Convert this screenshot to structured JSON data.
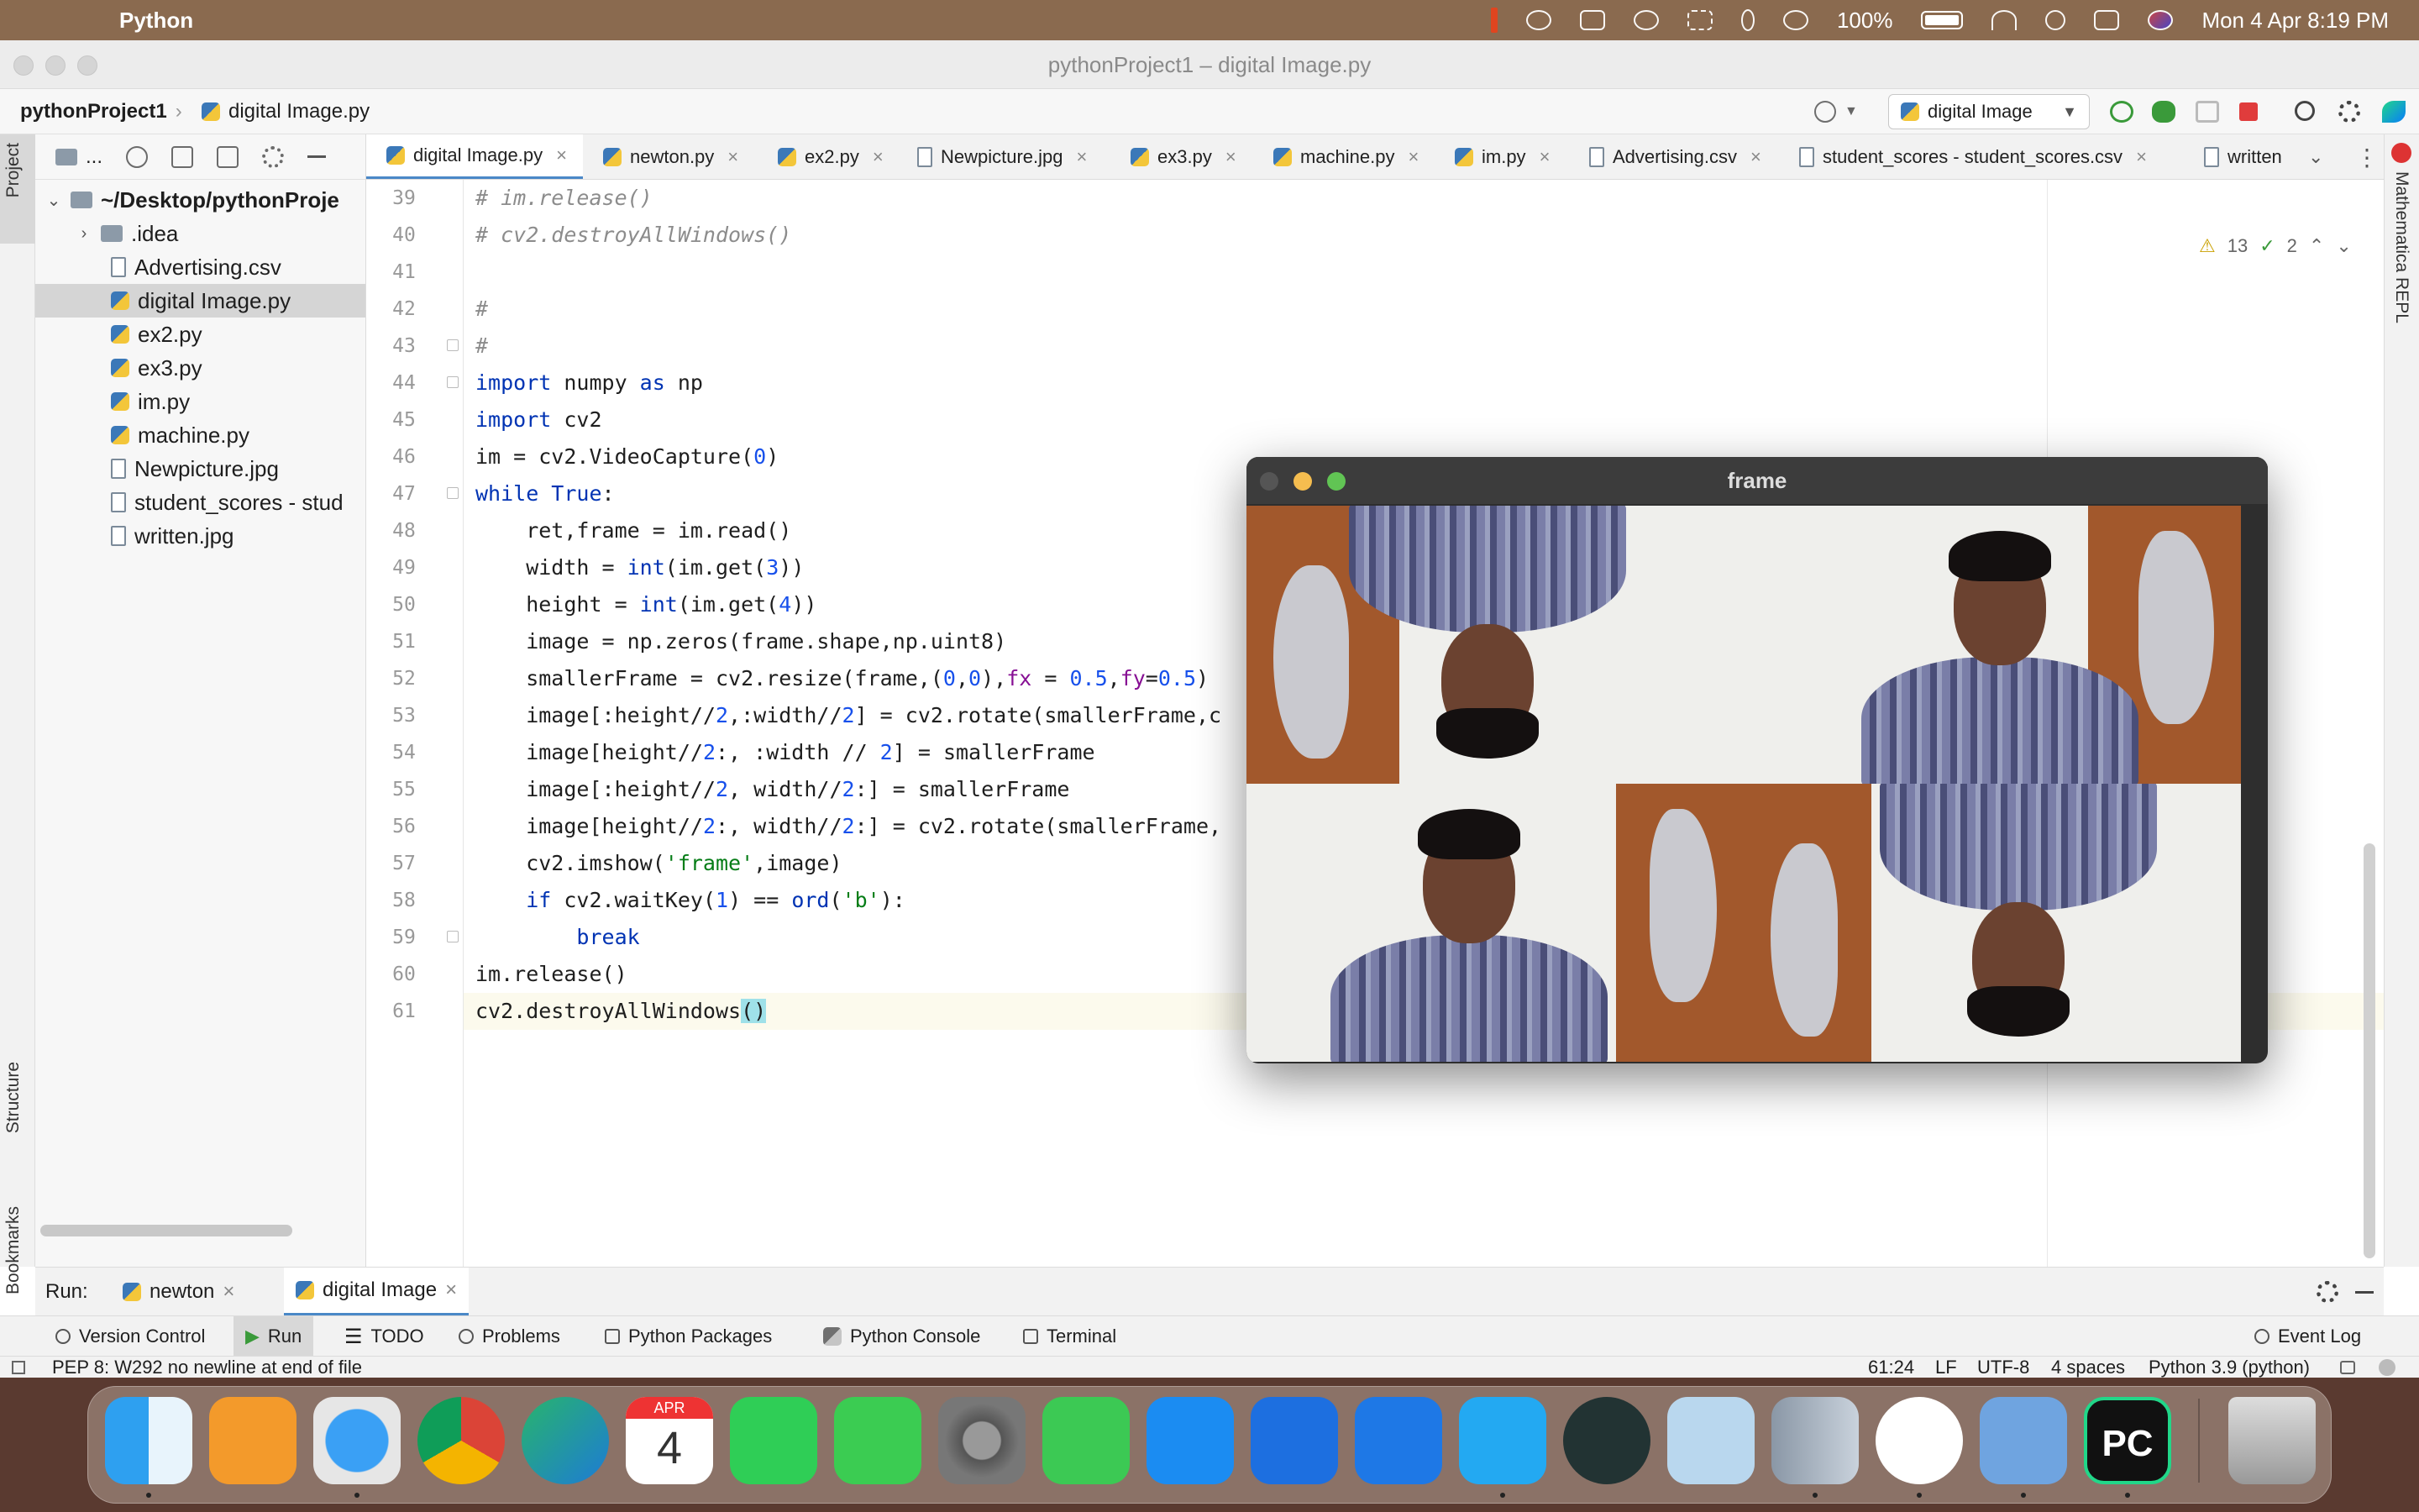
{
  "menubar": {
    "app_name": "Python",
    "battery": "100%",
    "datetime": "Mon 4 Apr  8:19 PM"
  },
  "window": {
    "title": "pythonProject1 – digital Image.py"
  },
  "navbar": {
    "project": "pythonProject1",
    "file": "digital Image.py",
    "run_config": "digital Image"
  },
  "sidebar": {
    "tab_project": "Project",
    "tab_structure": "Structure",
    "tab_bookmarks": "Bookmarks",
    "toolbar_label": "...",
    "root": "~/Desktop/pythonProje",
    "items": [
      {
        "label": ".idea",
        "type": "folder"
      },
      {
        "label": "Advertising.csv",
        "type": "file"
      },
      {
        "label": "digital Image.py",
        "type": "py"
      },
      {
        "label": "ex2.py",
        "type": "py"
      },
      {
        "label": "ex3.py",
        "type": "py"
      },
      {
        "label": "im.py",
        "type": "py"
      },
      {
        "label": "machine.py",
        "type": "py"
      },
      {
        "label": "Newpicture.jpg",
        "type": "file"
      },
      {
        "label": "student_scores - stud",
        "type": "file"
      },
      {
        "label": "written.jpg",
        "type": "file"
      }
    ]
  },
  "right_panel": {
    "label": "Mathematica REPL"
  },
  "tabs": [
    "digital Image.py",
    "newton.py",
    "ex2.py",
    "Newpicture.jpg",
    "ex3.py",
    "machine.py",
    "im.py",
    "Advertising.csv",
    "student_scores - student_scores.csv",
    "written"
  ],
  "editor": {
    "warnings": "13",
    "checks": "2",
    "line_numbers": [
      "39",
      "40",
      "41",
      "42",
      "43",
      "44",
      "45",
      "46",
      "47",
      "48",
      "49",
      "50",
      "51",
      "52",
      "53",
      "54",
      "55",
      "56",
      "57",
      "58",
      "59",
      "60",
      "61"
    ]
  },
  "frame_window": {
    "title": "frame"
  },
  "run_bar": {
    "label": "Run:",
    "tabs": [
      "newton",
      "digital Image"
    ]
  },
  "tool_windows": [
    "Version Control",
    "Run",
    "TODO",
    "Problems",
    "Python Packages",
    "Python Console",
    "Terminal",
    "Event Log"
  ],
  "status": {
    "message": "PEP 8: W292 no newline at end of file",
    "position": "61:24",
    "line_sep": "LF",
    "encoding": "UTF-8",
    "indent": "4 spaces",
    "interpreter": "Python 3.9 (python)"
  },
  "dock": {
    "calendar_month": "APR",
    "calendar_day": "4",
    "pycharm_label": "PC"
  }
}
